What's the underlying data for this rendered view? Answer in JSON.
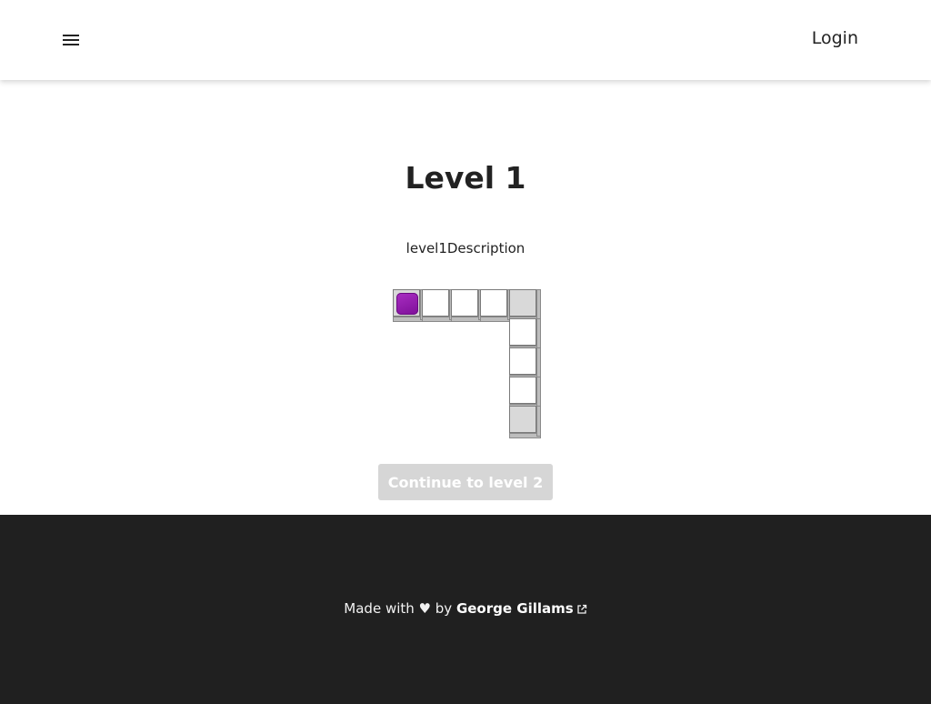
{
  "header": {
    "menu_icon": "menu-icon",
    "login_label": "Login"
  },
  "main": {
    "title": "Level 1",
    "description": "level1Description",
    "continue_label": "Continue to level 2"
  },
  "board": {
    "cells": [
      {
        "col": 0,
        "row": 0,
        "fill": "#d9d9d9",
        "player": true
      },
      {
        "col": 1,
        "row": 0,
        "fill": "#ffffff",
        "player": false
      },
      {
        "col": 2,
        "row": 0,
        "fill": "#ffffff",
        "player": false
      },
      {
        "col": 3,
        "row": 0,
        "fill": "#ffffff",
        "player": false
      },
      {
        "col": 4,
        "row": 0,
        "fill": "#d9d9d9",
        "player": false
      },
      {
        "col": 4,
        "row": 1,
        "fill": "#ffffff",
        "player": false
      },
      {
        "col": 4,
        "row": 2,
        "fill": "#ffffff",
        "player": false
      },
      {
        "col": 4,
        "row": 3,
        "fill": "#ffffff",
        "player": false
      },
      {
        "col": 4,
        "row": 4,
        "fill": "#d9d9d9",
        "player": false
      }
    ],
    "player_color": "#8e1aa8"
  },
  "footer": {
    "made_with": "Made with ♥ by",
    "author": "George Gillams",
    "link_icon": "external-link-icon"
  }
}
